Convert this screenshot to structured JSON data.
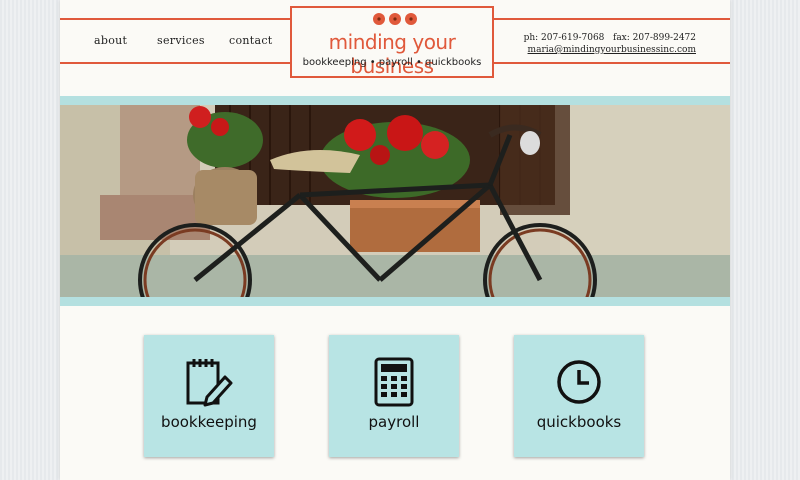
{
  "nav": {
    "about": "about",
    "services": "services",
    "contact": "contact"
  },
  "logo": {
    "title": "minding your business",
    "subtitle": "bookkeeping • payroll • quickbooks"
  },
  "contact": {
    "phone_fax": "ph: 207-619-7068   fax: 207-899-2472",
    "email": "maria@mindingyourbusinessinc.com"
  },
  "cards": [
    {
      "label": "bookkeeping",
      "icon": "notepad-pencil-icon"
    },
    {
      "label": "payroll",
      "icon": "calculator-icon"
    },
    {
      "label": "quickbooks",
      "icon": "clock-icon"
    }
  ],
  "colors": {
    "accent": "#e0593b",
    "teal": "#b4e0e0",
    "card": "#b8e4e4"
  }
}
